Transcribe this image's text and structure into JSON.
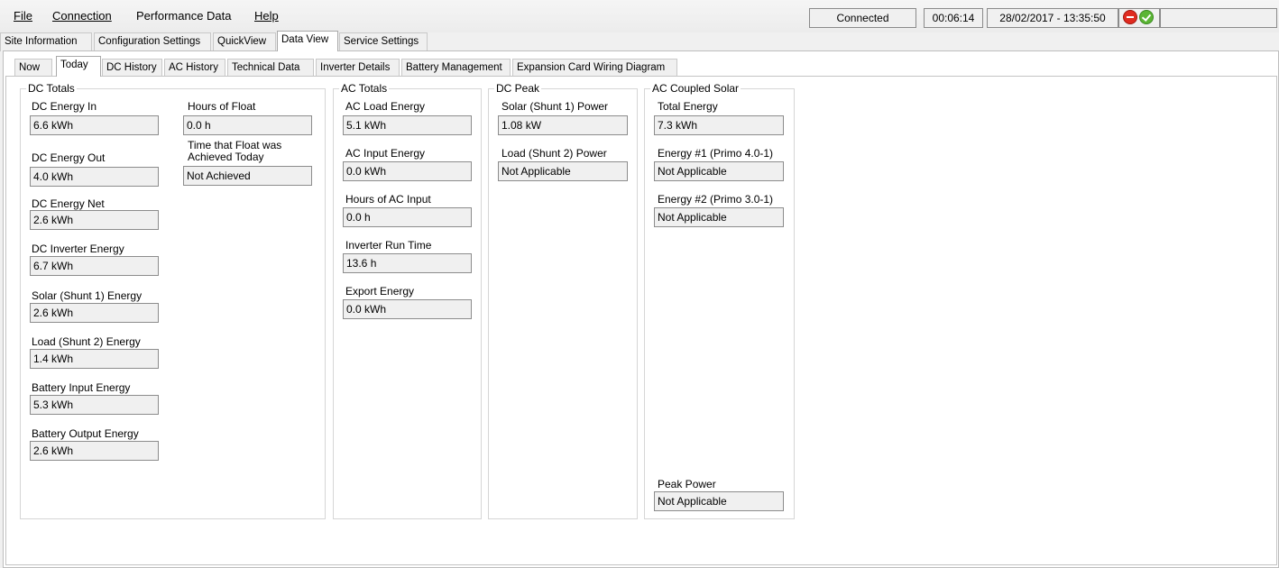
{
  "menu": {
    "file": "File",
    "connection": "Connection",
    "performance_data": "Performance Data",
    "help": "Help"
  },
  "status": {
    "connection": "Connected",
    "elapsed": "00:06:14",
    "datetime": "28/02/2017 - 13:35:50",
    "colors": {
      "stop": "#e02b20",
      "ok": "#5bb534"
    }
  },
  "main_tabs": [
    "Site Information",
    "Configuration Settings",
    "QuickView",
    "Data View",
    "Service Settings"
  ],
  "sub_tabs": [
    "Now",
    "Today",
    "DC History",
    "AC History",
    "Technical Data",
    "Inverter Details",
    "Battery Management",
    "Expansion Card Wiring Diagram"
  ],
  "dc_totals": {
    "title": "DC Totals",
    "dc_energy_in": {
      "label": "DC Energy In",
      "value": "6.6 kWh"
    },
    "dc_energy_out": {
      "label": "DC Energy Out",
      "value": "4.0 kWh"
    },
    "dc_energy_net": {
      "label": "DC Energy Net",
      "value": "2.6 kWh"
    },
    "dc_inverter_energy": {
      "label": "DC Inverter Energy",
      "value": "6.7 kWh"
    },
    "solar_energy": {
      "label": "Solar (Shunt 1) Energy",
      "value": "2.6 kWh"
    },
    "load_energy": {
      "label": "Load (Shunt 2) Energy",
      "value": "1.4 kWh"
    },
    "battery_input": {
      "label": "Battery Input Energy",
      "value": "5.3 kWh"
    },
    "battery_output": {
      "label": "Battery Output Energy",
      "value": "2.6 kWh"
    },
    "hours_of_float": {
      "label": "Hours of Float",
      "value": "0.0 h"
    },
    "float_time": {
      "label_line1": "Time that Float was",
      "label_line2": "Achieved Today",
      "value": "Not Achieved"
    }
  },
  "ac_totals": {
    "title": "AC Totals",
    "ac_load_energy": {
      "label": "AC Load Energy",
      "value": "5.1 kWh"
    },
    "ac_input_energy": {
      "label": "AC Input Energy",
      "value": "0.0 kWh"
    },
    "hours_ac_input": {
      "label": "Hours of AC Input",
      "value": "0.0 h"
    },
    "inverter_run_time": {
      "label": "Inverter Run Time",
      "value": "13.6 h"
    },
    "export_energy": {
      "label": "Export Energy",
      "value": "0.0 kWh"
    }
  },
  "dc_peak": {
    "title": "DC Peak",
    "solar_power": {
      "label": "Solar (Shunt 1) Power",
      "value": "1.08 kW"
    },
    "load_power": {
      "label": "Load (Shunt 2) Power",
      "value": "Not Applicable"
    }
  },
  "ac_coupled": {
    "title": "AC Coupled Solar",
    "total_energy": {
      "label": "Total Energy",
      "value": "7.3 kWh"
    },
    "energy_1": {
      "label": "Energy #1 (Primo 4.0-1)",
      "value": "Not Applicable"
    },
    "energy_2": {
      "label": "Energy #2 (Primo 3.0-1)",
      "value": "Not Applicable"
    },
    "peak_power": {
      "label": "Peak Power",
      "value": "Not Applicable"
    }
  }
}
